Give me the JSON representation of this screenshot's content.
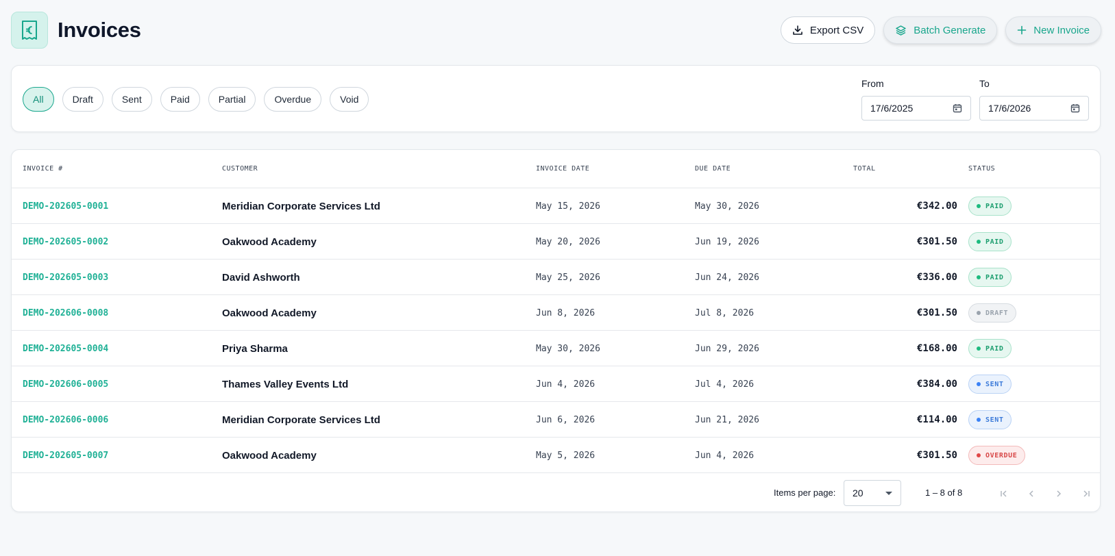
{
  "header": {
    "title": "Invoices",
    "logo_icon": "euro-receipt-icon",
    "export_label": "Export CSV",
    "batch_label": "Batch Generate",
    "new_label": "New Invoice"
  },
  "filters": {
    "chips": [
      "All",
      "Draft",
      "Sent",
      "Paid",
      "Partial",
      "Overdue",
      "Void"
    ],
    "active": "All",
    "from_label": "From",
    "from_value": "17/6/2025",
    "to_label": "To",
    "to_value": "17/6/2026"
  },
  "table": {
    "columns": {
      "invoice": "INVOICE #",
      "customer": "CUSTOMER",
      "invoice_date": "INVOICE DATE",
      "due_date": "DUE DATE",
      "total": "TOTAL",
      "status": "STATUS"
    },
    "rows": [
      {
        "invoice": "DEMO-202605-0001",
        "customer": "Meridian Corporate Services Ltd",
        "invoice_date": "May 15, 2026",
        "due_date": "May 30, 2026",
        "total": "€342.00",
        "status": "PAID"
      },
      {
        "invoice": "DEMO-202605-0002",
        "customer": "Oakwood Academy",
        "invoice_date": "May 20, 2026",
        "due_date": "Jun 19, 2026",
        "total": "€301.50",
        "status": "PAID"
      },
      {
        "invoice": "DEMO-202605-0003",
        "customer": "David Ashworth",
        "invoice_date": "May 25, 2026",
        "due_date": "Jun 24, 2026",
        "total": "€336.00",
        "status": "PAID"
      },
      {
        "invoice": "DEMO-202606-0008",
        "customer": "Oakwood Academy",
        "invoice_date": "Jun 8, 2026",
        "due_date": "Jul 8, 2026",
        "total": "€301.50",
        "status": "DRAFT"
      },
      {
        "invoice": "DEMO-202605-0004",
        "customer": "Priya Sharma",
        "invoice_date": "May 30, 2026",
        "due_date": "Jun 29, 2026",
        "total": "€168.00",
        "status": "PAID"
      },
      {
        "invoice": "DEMO-202606-0005",
        "customer": "Thames Valley Events Ltd",
        "invoice_date": "Jun 4, 2026",
        "due_date": "Jul 4, 2026",
        "total": "€384.00",
        "status": "SENT"
      },
      {
        "invoice": "DEMO-202606-0006",
        "customer": "Meridian Corporate Services Ltd",
        "invoice_date": "Jun 6, 2026",
        "due_date": "Jun 21, 2026",
        "total": "€114.00",
        "status": "SENT"
      },
      {
        "invoice": "DEMO-202605-0007",
        "customer": "Oakwood Academy",
        "invoice_date": "May 5, 2026",
        "due_date": "Jun 4, 2026",
        "total": "€301.50",
        "status": "OVERDUE"
      }
    ]
  },
  "footer": {
    "items_per_page_label": "Items per page:",
    "items_per_page_value": "20",
    "range_label": "1 – 8 of 8"
  },
  "colors": {
    "accent": "#18a68c",
    "paid": "#1d9e6f",
    "draft": "#9aa3ad",
    "sent": "#3b7ad9",
    "overdue": "#d84848"
  }
}
